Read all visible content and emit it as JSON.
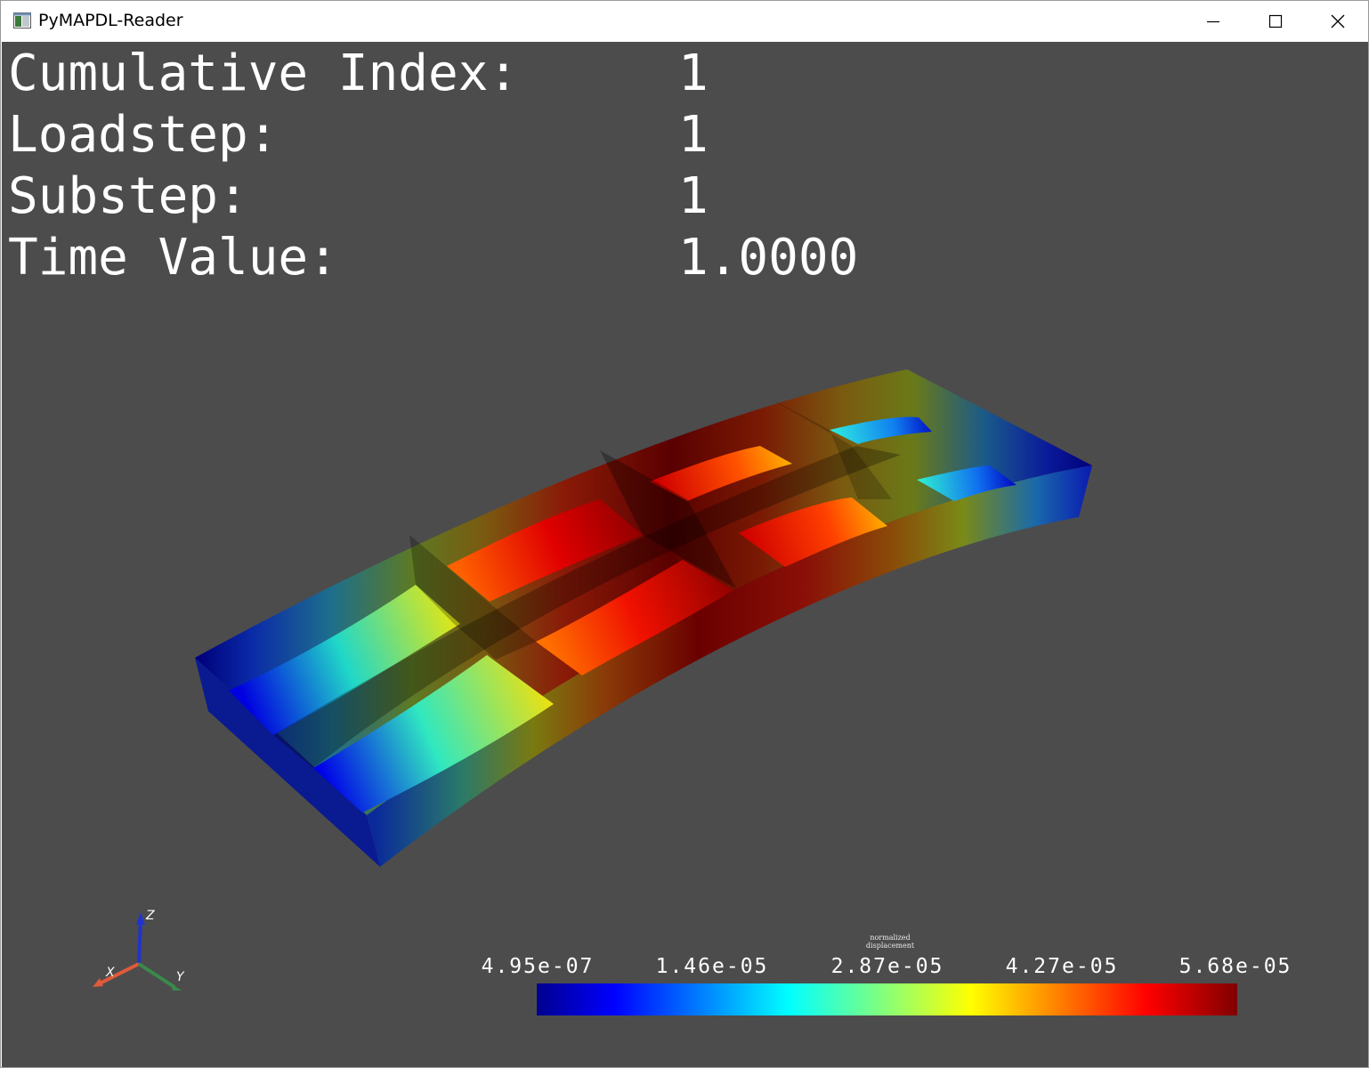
{
  "window": {
    "title": "PyMAPDL-Reader",
    "controls": {
      "minimize": "minimize-icon",
      "maximize": "maximize-icon",
      "close": "close-icon"
    }
  },
  "viewport": {
    "background": "#4c4c4c"
  },
  "info": [
    {
      "label": "Cumulative Index:",
      "value": "1"
    },
    {
      "label": "Loadstep:",
      "value": "1"
    },
    {
      "label": "Substep:",
      "value": "1"
    },
    {
      "label": "Time Value:",
      "value": "1.0000"
    }
  ],
  "axes": {
    "x": "X",
    "y": "Y",
    "z": "Z",
    "colors": {
      "x": "#e05a3a",
      "y": "#3a8a4a",
      "z": "#2233cc"
    }
  },
  "scalar_bar": {
    "title": "normalized displacement",
    "ticks": [
      "4.95e-07",
      "1.46e-05",
      "2.87e-05",
      "4.27e-05",
      "5.68e-05"
    ],
    "colormap": "jet"
  }
}
